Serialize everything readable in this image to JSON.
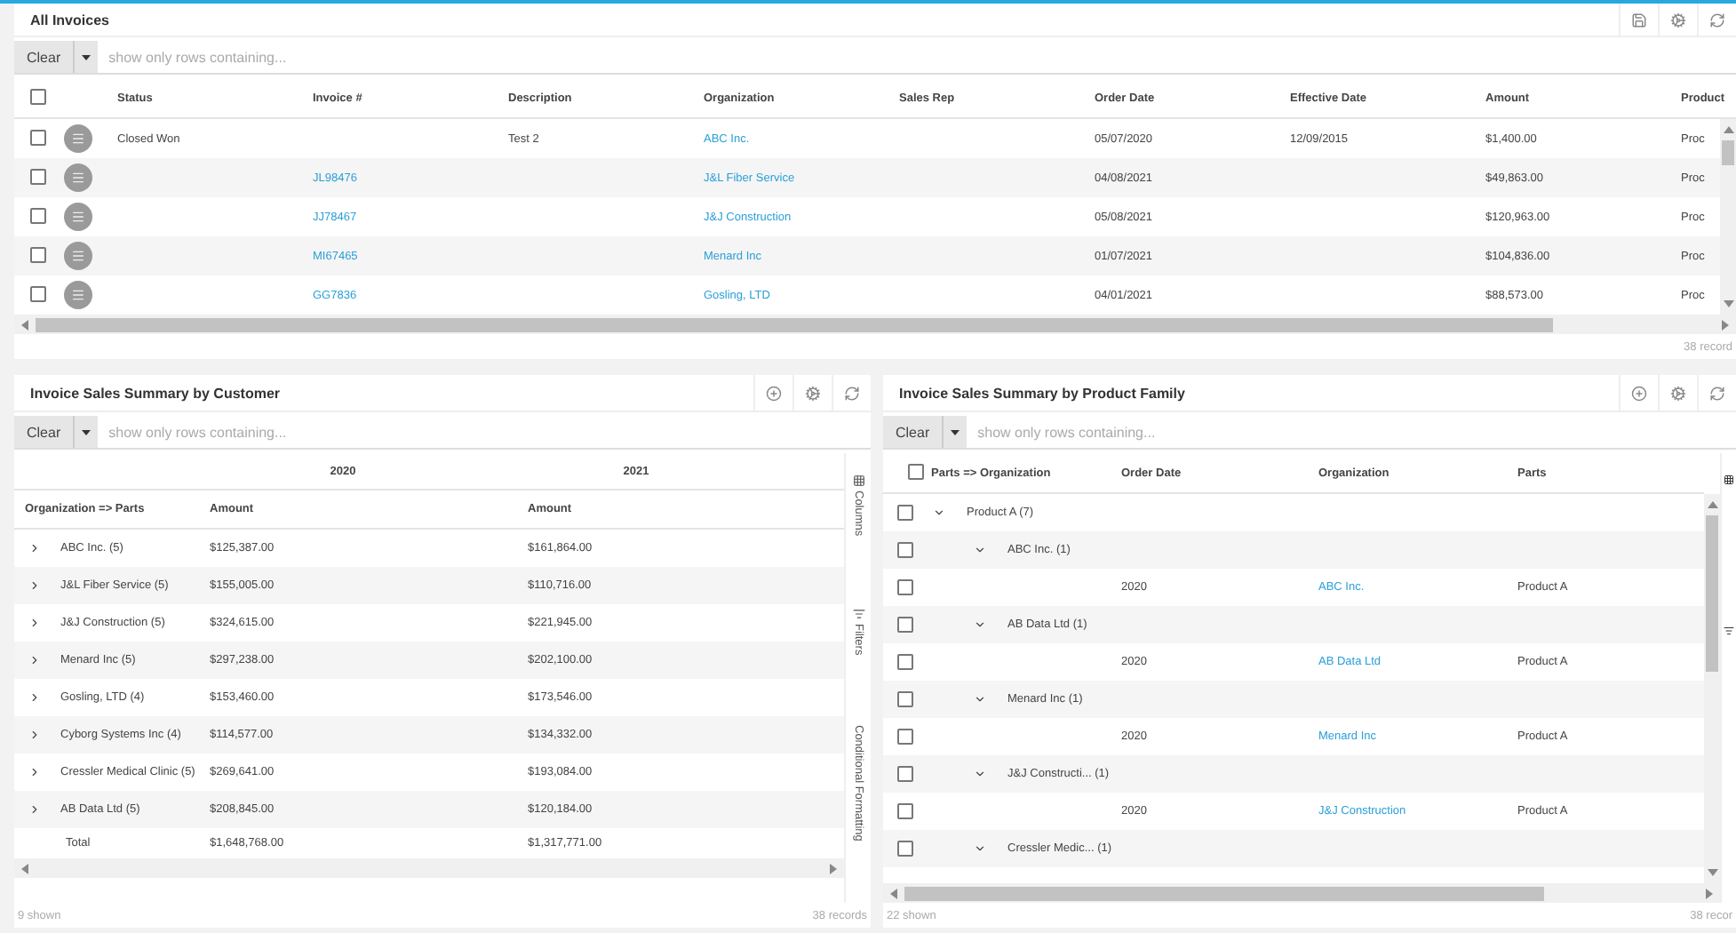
{
  "invoices": {
    "title": "All Invoices",
    "filter": {
      "button": "Clear",
      "placeholder": "show only rows containing..."
    },
    "header_checked": false,
    "columns": [
      "Status",
      "Invoice #",
      "Description",
      "Organization",
      "Sales Rep",
      "Order Date",
      "Effective Date",
      "Amount",
      "Product"
    ],
    "rows": [
      {
        "checked": false,
        "cells": [
          "Closed Won",
          "",
          "Test 2",
          "ABC Inc.",
          "",
          "05/07/2020",
          "12/09/2015",
          "$1,400.00",
          "Proc"
        ]
      },
      {
        "checked": false,
        "cells": [
          "",
          "JL98476",
          "",
          "J&L Fiber Service",
          "",
          "04/08/2021",
          "",
          "$49,863.00",
          "Proc"
        ]
      },
      {
        "checked": false,
        "cells": [
          "",
          "JJ78467",
          "",
          "J&J Construction",
          "",
          "05/08/2021",
          "",
          "$120,963.00",
          "Proc"
        ]
      },
      {
        "checked": false,
        "cells": [
          "",
          "MI67465",
          "",
          "Menard Inc",
          "",
          "01/07/2021",
          "",
          "$104,836.00",
          "Proc"
        ]
      },
      {
        "checked": false,
        "cells": [
          "",
          "GG7836",
          "",
          "Gosling, LTD",
          "",
          "04/01/2021",
          "",
          "$88,573.00",
          "Proc"
        ]
      }
    ],
    "footer": "38 record"
  },
  "customer_summary": {
    "title": "Invoice Sales Summary by Customer",
    "filter": {
      "button": "Clear",
      "placeholder": "show only rows containing..."
    },
    "group_headers": [
      "2020",
      "2021"
    ],
    "columns": [
      "Organization => Parts",
      "Amount",
      "Amount"
    ],
    "rows": [
      {
        "expanded": false,
        "cells": [
          "ABC Inc. (5)",
          "$125,387.00",
          "$161,864.00"
        ]
      },
      {
        "expanded": false,
        "cells": [
          "J&L Fiber Service (5)",
          "$155,005.00",
          "$110,716.00"
        ]
      },
      {
        "expanded": false,
        "cells": [
          "J&J Construction (5)",
          "$324,615.00",
          "$221,945.00"
        ]
      },
      {
        "expanded": false,
        "cells": [
          "Menard Inc (5)",
          "$297,238.00",
          "$202,100.00"
        ]
      },
      {
        "expanded": false,
        "cells": [
          "Gosling, LTD (4)",
          "$153,460.00",
          "$173,546.00"
        ]
      },
      {
        "expanded": false,
        "cells": [
          "Cyborg Systems Inc (4)",
          "$114,577.00",
          "$134,332.00"
        ]
      },
      {
        "expanded": false,
        "cells": [
          "Cressler Medical Clinic (5)",
          "$269,641.00",
          "$193,084.00"
        ]
      },
      {
        "expanded": false,
        "cells": [
          "AB Data Ltd (5)",
          "$208,845.00",
          "$120,184.00"
        ]
      }
    ],
    "total": [
      "Total",
      "$1,648,768.00",
      "$1,317,771.00"
    ],
    "side_tabs": [
      "Columns",
      "Filters",
      "Conditional Formatting"
    ],
    "shown": "9 shown",
    "records": "38 records"
  },
  "product_summary": {
    "title": "Invoice Sales Summary by Product Family",
    "filter": {
      "button": "Clear",
      "placeholder": "show only rows containing..."
    },
    "header_checked": false,
    "columns": [
      "Parts => Organization",
      "Order Date",
      "Organization",
      "Parts"
    ],
    "tree": [
      {
        "label": "Product A (7)",
        "checked": false,
        "expanded": true,
        "children": [
          {
            "label": "ABC Inc. (1)",
            "checked": false,
            "expanded": true,
            "children": [
              {
                "checked": false,
                "order_date": "2020",
                "organization": "ABC Inc.",
                "parts": "Product A"
              }
            ]
          },
          {
            "label": "AB Data Ltd (1)",
            "checked": false,
            "expanded": true,
            "children": [
              {
                "checked": false,
                "order_date": "2020",
                "organization": "AB Data Ltd",
                "parts": "Product A"
              }
            ]
          },
          {
            "label": "Menard Inc (1)",
            "checked": false,
            "expanded": true,
            "children": [
              {
                "checked": false,
                "order_date": "2020",
                "organization": "Menard Inc",
                "parts": "Product A"
              }
            ]
          },
          {
            "label": "J&J Constructi... (1)",
            "checked": false,
            "expanded": true,
            "children": [
              {
                "checked": false,
                "order_date": "2020",
                "organization": "J&J Construction",
                "parts": "Product A"
              }
            ]
          },
          {
            "label": "Cressler Medic... (1)",
            "checked": false,
            "expanded": true
          }
        ]
      }
    ],
    "shown": "22 shown",
    "records": "38 recor"
  }
}
